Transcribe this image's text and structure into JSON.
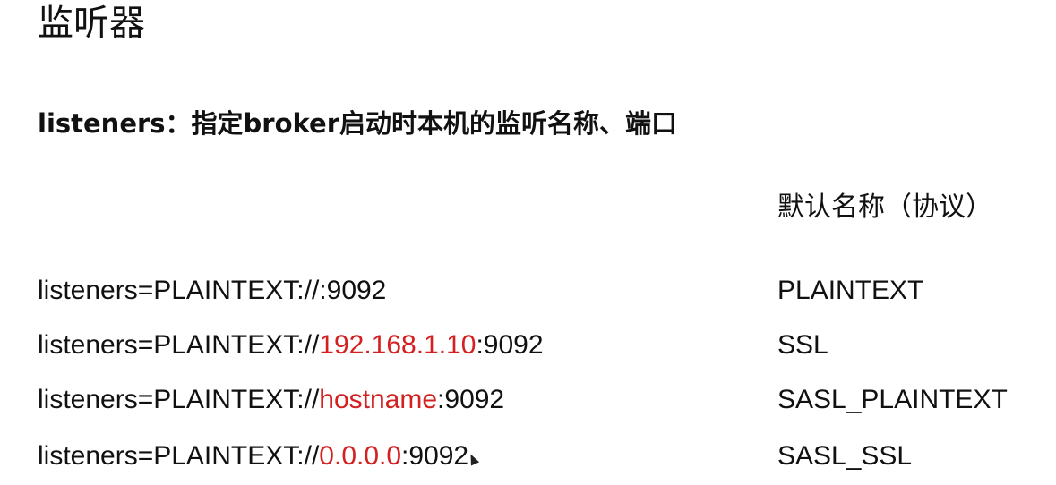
{
  "title": "监听器",
  "subtitle": "listeners：指定broker启动时本机的监听名称、端口",
  "protocol_header": "默认名称（协议）",
  "listener_prefix": "listeners=PLAINTEXT://",
  "listeners": [
    {
      "host": "",
      "port_suffix": ":9092"
    },
    {
      "host": "192.168.1.10",
      "port_suffix": ":9092"
    },
    {
      "host": "hostname",
      "port_suffix": ":9092"
    },
    {
      "host": "0.0.0.0",
      "port_suffix": ":9092"
    }
  ],
  "protocols": [
    "PLAINTEXT",
    "SSL",
    "SASL_PLAINTEXT",
    "SASL_SSL"
  ],
  "colors": {
    "highlight": "#d42020",
    "text": "#111111"
  }
}
